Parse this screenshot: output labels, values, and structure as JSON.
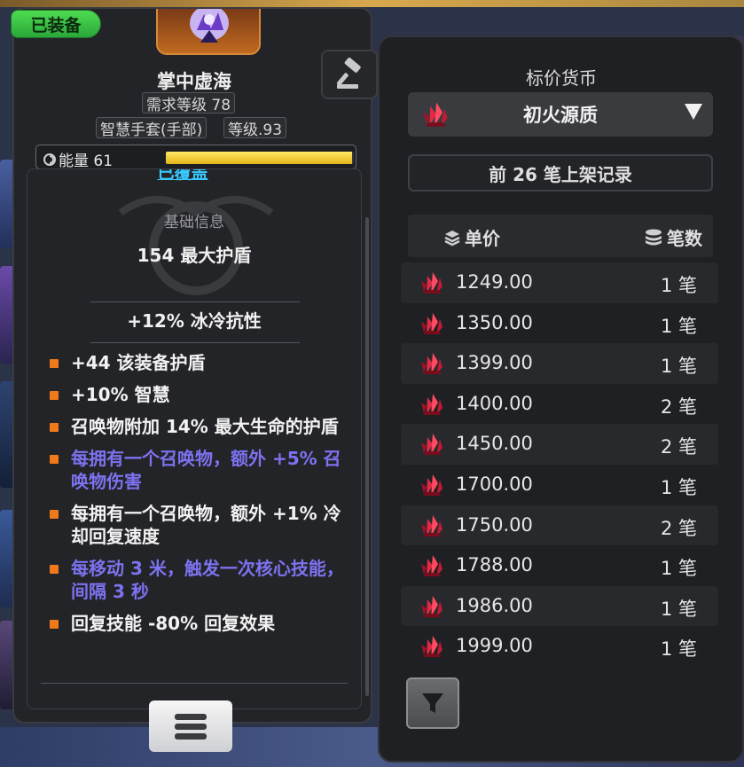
{
  "item": {
    "equipped_badge": "已装备",
    "name": "掌中虚海",
    "required_level": "需求等级 78",
    "item_type": "智慧手套(手部)",
    "item_level": "等级.93",
    "energy_label": "能量 61",
    "energy_fraction": 0.99,
    "partial_text": "已覆盖",
    "base_section_title": "基础信息",
    "base_stat": "154 最大护盾",
    "implicit": "+12% 冰冷抗性",
    "affixes": [
      {
        "text": "+44 该装备护盾",
        "color": "white"
      },
      {
        "text": "+10% 智慧",
        "color": "white"
      },
      {
        "text": "召唤物附加 14% 最大生命的护盾",
        "color": "white"
      },
      {
        "text": "每拥有一个召唤物，额外 +5% 召唤物伤害",
        "color": "purple"
      },
      {
        "text": "每拥有一个召唤物，额外 +1% 冷却回复速度",
        "color": "white"
      },
      {
        "text": "每移动 3 米，触发一次核心技能，间隔 3 秒",
        "color": "purple"
      },
      {
        "text": "回复技能 -80% 回复效果",
        "color": "white"
      }
    ]
  },
  "icons": {
    "gavel": "gavel-icon",
    "menu": "menu-icon",
    "filter": "filter-icon",
    "currency": "red-crystal-icon",
    "stack": "stack-icon",
    "coins": "coins-icon",
    "dropdown": "triangle-down-icon"
  },
  "market": {
    "title": "标价货币",
    "currency": "初火源质",
    "records_label": "前 26 笔上架记录",
    "col_price": "单价",
    "col_count": "笔数",
    "rows": [
      {
        "price": "1249.00",
        "count": "1 笔"
      },
      {
        "price": "1350.00",
        "count": "1 笔"
      },
      {
        "price": "1399.00",
        "count": "1 笔"
      },
      {
        "price": "1400.00",
        "count": "2 笔"
      },
      {
        "price": "1450.00",
        "count": "2 笔"
      },
      {
        "price": "1700.00",
        "count": "1 笔"
      },
      {
        "price": "1750.00",
        "count": "2 笔"
      },
      {
        "price": "1788.00",
        "count": "1 笔"
      },
      {
        "price": "1986.00",
        "count": "1 笔"
      },
      {
        "price": "1999.00",
        "count": "1 笔"
      }
    ]
  },
  "colors": {
    "accent_green": "#2aa83a",
    "bullet_orange": "#f07a1a",
    "purple_affix": "#7d72f0",
    "energy_yellow": "#f0c832",
    "crystal_red": "#d0263a"
  }
}
